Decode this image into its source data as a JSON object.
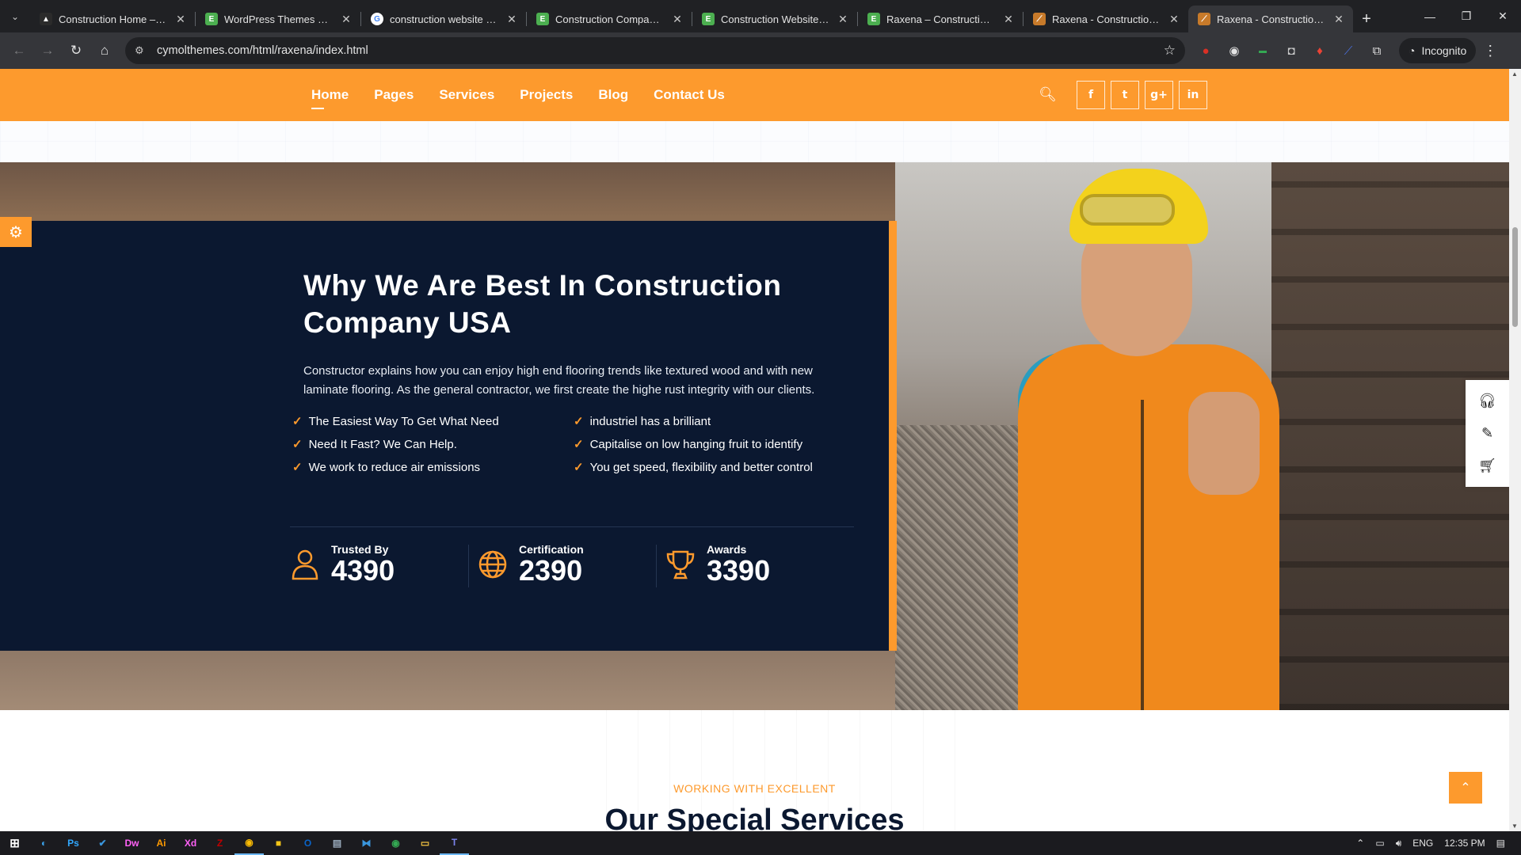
{
  "browser": {
    "tabs": [
      {
        "title": "Construction Home – Con",
        "fav_color": "#2b2b2b",
        "fav_glyph": "▲"
      },
      {
        "title": "WordPress Themes & We",
        "fav_color": "#4caf50",
        "fav_glyph": "E"
      },
      {
        "title": "construction website tem",
        "fav_color": "#ffffff",
        "fav_glyph": "G"
      },
      {
        "title": "Construction Company W",
        "fav_color": "#4caf50",
        "fav_glyph": "E"
      },
      {
        "title": "Construction Website Ten",
        "fav_color": "#4caf50",
        "fav_glyph": "E"
      },
      {
        "title": "Raxena – Construction HT",
        "fav_color": "#4caf50",
        "fav_glyph": "E"
      },
      {
        "title": "Raxena - Construction HT",
        "fav_color": "#c77a2a",
        "fav_glyph": "⟋"
      },
      {
        "title": "Raxena - Construction HT",
        "fav_color": "#c77a2a",
        "fav_glyph": "⟋"
      }
    ],
    "active_tab_index": 7,
    "url": "cymolthemes.com/html/raxena/index.html",
    "incognito_label": "Incognito"
  },
  "nav": {
    "items": [
      {
        "label": "Home",
        "current": true
      },
      {
        "label": "Pages",
        "current": false
      },
      {
        "label": "Services",
        "current": false
      },
      {
        "label": "Projects",
        "current": false
      },
      {
        "label": "Blog",
        "current": false
      },
      {
        "label": "Contact Us",
        "current": false
      }
    ],
    "social": [
      "f",
      "t",
      "g+",
      "in"
    ]
  },
  "hero": {
    "title": "Why We Are Best In Construction Company USA",
    "text": "Constructor explains how you can enjoy high end flooring trends like textured wood and with new laminate flooring. As the general contractor, we first create the highe rust integrity with our clients.",
    "features": [
      "The Easiest Way To Get What Need",
      "industriel has a brilliant",
      "Need It Fast? We Can Help.",
      "Capitalise on low hanging fruit to identify",
      "We work to reduce air emissions",
      "You get speed, flexibility and better control"
    ],
    "stats": [
      {
        "label": "Trusted By",
        "value": "4390",
        "icon": "user-icon"
      },
      {
        "label": "Certification",
        "value": "2390",
        "icon": "globe-icon"
      },
      {
        "label": "Awards",
        "value": "3390",
        "icon": "trophy-icon"
      }
    ]
  },
  "services": {
    "eyebrow": "WORKING WITH EXCELLENT",
    "heading": "Our Special Services"
  },
  "taskbar": {
    "lang": "ENG",
    "time": "12:35 PM"
  },
  "colors": {
    "accent": "#fd9a2d",
    "navy": "#0b1830"
  }
}
